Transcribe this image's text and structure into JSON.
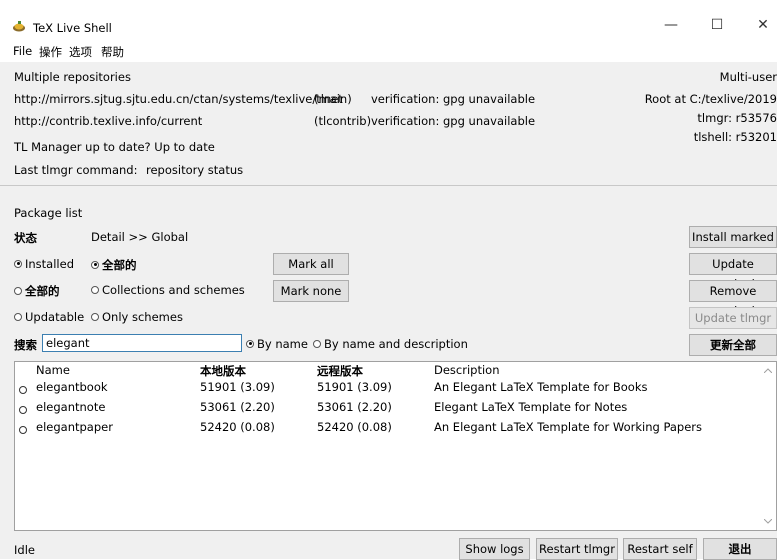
{
  "window": {
    "title": "TeX Live Shell",
    "minimize": "—",
    "maximize": "☐",
    "close": "✕"
  },
  "menu": {
    "file": "File",
    "operations": "操作",
    "options": "选项",
    "help": "帮助"
  },
  "repos": {
    "header": "Multiple repositories",
    "main_url": "http://mirrors.sjtug.sjtu.edu.cn/ctan/systems/texlive/tlnet",
    "main_tag": "(main)",
    "main_verif": "verification: gpg unavailable",
    "contrib_url": "http://contrib.texlive.info/current",
    "contrib_tag": "(tlcontrib)",
    "contrib_verif": "verification: gpg unavailable",
    "tlm_status": "TL Manager up to date?  Up to date",
    "last_cmd_label": "Last tlmgr command:",
    "last_cmd_value": "repository status",
    "right_multiuser": "Multi-user",
    "right_root": "Root at C:/texlive/2019",
    "right_tlmgr": "tlmgr: r53576",
    "right_tlshell": "tlshell: r53201"
  },
  "pkg": {
    "section": "Package list",
    "status_label": "状态",
    "detail": "Detail >> Global",
    "r_installed": "Installed",
    "r_all1": "全部的",
    "r_all2": "全部的",
    "r_collections": "Collections and schemes",
    "r_updatable": "Updatable",
    "r_only_schemes": "Only schemes",
    "mark_all": "Mark all",
    "mark_none": "Mark none",
    "install_marked": "Install marked",
    "update_marked": "Update marked",
    "remove_marked": "Remove marked",
    "update_tlmgr": "Update tlmgr",
    "update_all": "更新全部",
    "search_label": "搜索",
    "search_value": "elegant",
    "by_name": "By name",
    "by_name_desc": "By name and description"
  },
  "table": {
    "headers": {
      "name": "Name",
      "local": "本地版本",
      "remote": "远程版本",
      "desc": "Description"
    },
    "rows": [
      {
        "name": "elegantbook",
        "local": "51901 (3.09)",
        "remote": "51901 (3.09)",
        "desc": "An Elegant LaTeX Template for Books"
      },
      {
        "name": "elegantnote",
        "local": "53061 (2.20)",
        "remote": "53061 (2.20)",
        "desc": "Elegant LaTeX Template for Notes"
      },
      {
        "name": "elegantpaper",
        "local": "52420 (0.08)",
        "remote": "52420 (0.08)",
        "desc": "An Elegant LaTeX Template for Working Papers"
      }
    ]
  },
  "status": {
    "text": "Idle",
    "show_logs": "Show logs",
    "restart_tlmgr": "Restart tlmgr",
    "restart_self": "Restart self",
    "quit": "退出"
  }
}
